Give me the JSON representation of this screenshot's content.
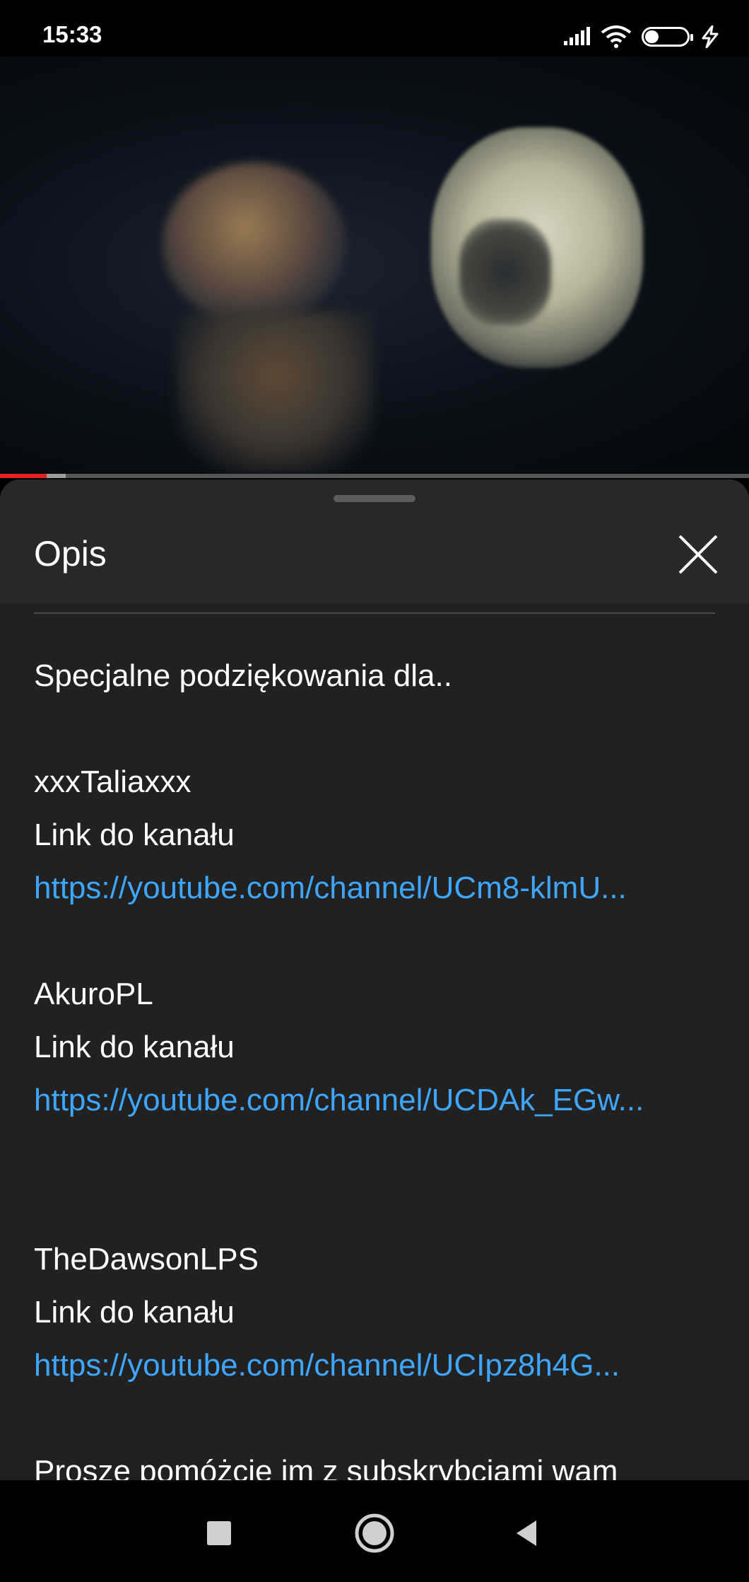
{
  "status_bar": {
    "time": "15:33",
    "battery_level": "31",
    "icons": [
      "signal-icon",
      "wifi-icon",
      "battery-icon",
      "charging-icon"
    ]
  },
  "video": {
    "progress_played_fraction": 0.062,
    "progress_buffered_fraction": 0.088,
    "colors": {
      "played": "#e52121",
      "buffer": "#9e9e9e"
    }
  },
  "description_panel": {
    "title": "Opis",
    "close_icon": "close-icon",
    "intro": "Specjalne podziękowania dla..",
    "entries": [
      {
        "name": "xxxTaliaxxx",
        "label": "Link do kanału",
        "url": "https://youtube.com/channel/UCm8-klmU..."
      },
      {
        "name": "AkuroPL",
        "label": "Link do kanału",
        "url": "https://youtube.com/channel/UCDAk_EGw..."
      },
      {
        "name": "TheDawsonLPS",
        "label": "Link do kanału",
        "url": "https://youtube.com/channel/UCIpz8h4G..."
      }
    ],
    "closing": "Proszę pomóżcie im z subskrybcjami wam",
    "link_color": "#3ea6ff"
  },
  "nav_bar": {
    "buttons": [
      "recents-icon",
      "home-icon",
      "back-icon"
    ]
  }
}
